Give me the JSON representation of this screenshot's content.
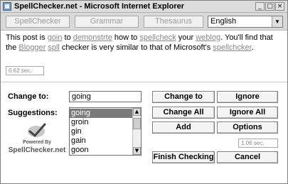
{
  "window": {
    "title": "SpellChecker.net - Microsoft Internet Explorer",
    "minimize": "_",
    "maximize": "□",
    "close": "×"
  },
  "tabs": [
    {
      "label": "SpellChecker"
    },
    {
      "label": "Grammar"
    },
    {
      "label": "Thesaurus"
    }
  ],
  "language": {
    "selected": "English"
  },
  "post": {
    "t1": "This post is ",
    "e1": "goin",
    "t2": " to ",
    "e2": "demonstrte",
    "t3": " how to ",
    "e3": "spellcheck",
    "t4": " your ",
    "e4": "weblog",
    "t5": ". You'll find that the ",
    "e5": "Blogger",
    "t6": " ",
    "e6": "spll",
    "t7": " checker is very similar to that of Microsoft's ",
    "e7": "spellchcker",
    "t8": "."
  },
  "timing_top": "0.62 sec.",
  "change_to": {
    "label": "Change to:",
    "value": "going"
  },
  "suggestions": {
    "label": "Suggestions:",
    "items": [
      "going",
      "groin",
      "gin",
      "gain",
      "goon"
    ],
    "selected_index": 0
  },
  "logo": {
    "powered": "Powered By",
    "brand": "SpellChecker.net"
  },
  "buttons": {
    "change_to": "Change to",
    "ignore": "Ignore",
    "change_all": "Change All",
    "ignore_all": "Ignore All",
    "add": "Add",
    "options": "Options",
    "finish": "Finish Checking",
    "cancel": "Cancel"
  },
  "timing_bottom": "1.06 sec.",
  "colors": {
    "selection": "#7a7a7a",
    "misspelled": "#888888"
  }
}
